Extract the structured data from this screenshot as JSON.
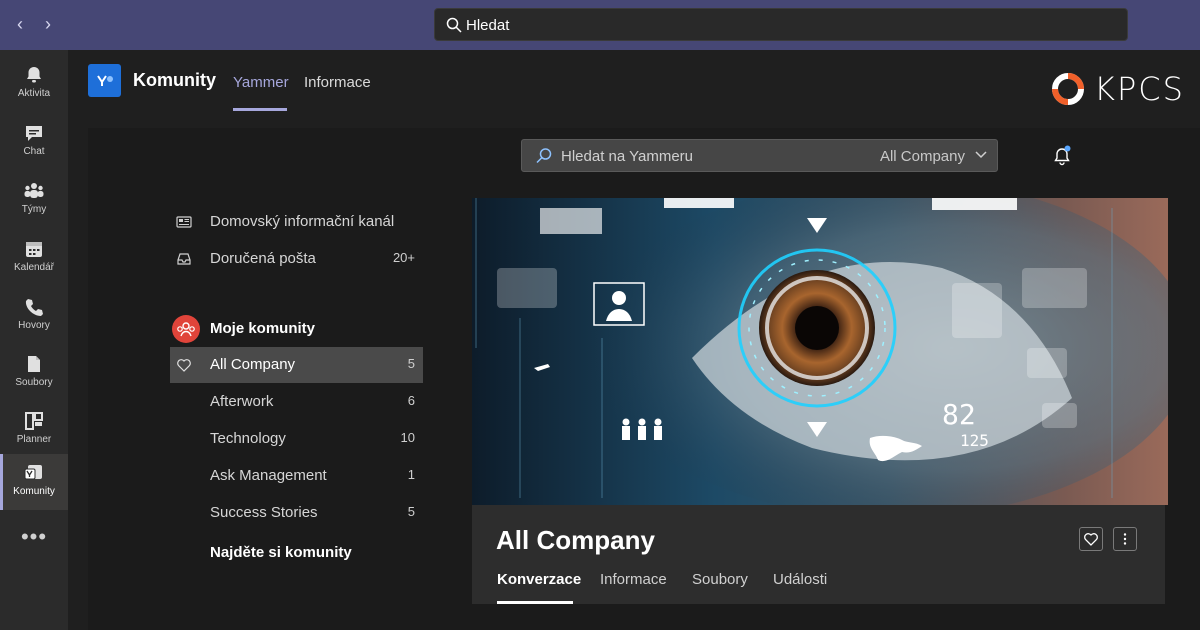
{
  "titlebar": {
    "back_label": "‹",
    "forward_label": "›",
    "search_placeholder": "Hledat"
  },
  "rail": {
    "items": [
      {
        "label": "Aktivita",
        "icon": "bell-icon"
      },
      {
        "label": "Chat",
        "icon": "chat-icon"
      },
      {
        "label": "Týmy",
        "icon": "teams-icon"
      },
      {
        "label": "Kalendář",
        "icon": "calendar-icon"
      },
      {
        "label": "Hovory",
        "icon": "phone-icon"
      },
      {
        "label": "Soubory",
        "icon": "file-icon"
      },
      {
        "label": "Planner",
        "icon": "planner-icon"
      },
      {
        "label": "Komunity",
        "icon": "yammer-icon"
      }
    ],
    "more_label": "•••",
    "active_index": 7
  },
  "header": {
    "title": "Komunity",
    "tabs": [
      {
        "label": "Yammer"
      },
      {
        "label": "Informace"
      }
    ],
    "brand": "KPCS"
  },
  "yammer_search": {
    "placeholder": "Hledat na Yammeru",
    "scope": "All Company"
  },
  "nav": {
    "home_feed": "Domovský informační kanál",
    "inbox": "Doručená pošta",
    "inbox_count": "20+",
    "my_communities": "Moje komunity",
    "communities": [
      {
        "label": "All Company",
        "count": "5"
      },
      {
        "label": "Afterwork",
        "count": "6"
      },
      {
        "label": "Technology",
        "count": "10"
      },
      {
        "label": "Ask Management",
        "count": "1"
      },
      {
        "label": "Success Stories",
        "count": "5"
      }
    ],
    "find_communities": "Najděte si komunity"
  },
  "hero": {
    "readout_top": "82",
    "readout_bottom": "125"
  },
  "group": {
    "title": "All Company",
    "tabs": [
      {
        "label": "Konverzace"
      },
      {
        "label": "Informace"
      },
      {
        "label": "Soubory"
      },
      {
        "label": "Události"
      }
    ]
  },
  "colors": {
    "titlebar": "#464775",
    "accent": "#a6a7dc",
    "yammer_blue": "#1e6fd9",
    "community_red": "#e0443a",
    "brand_orange": "#f0602a"
  }
}
